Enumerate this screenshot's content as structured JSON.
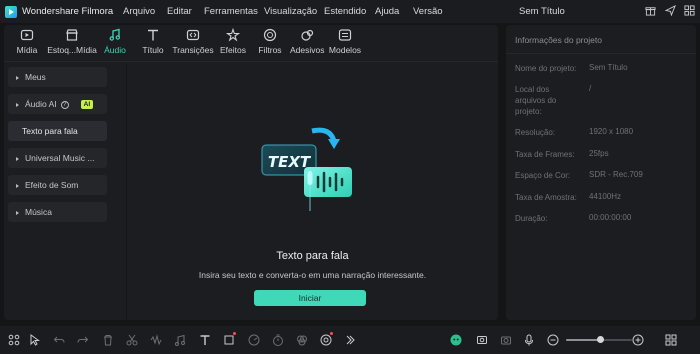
{
  "app": {
    "title": "Wondershare Filmora",
    "document_title": "Sem Título",
    "menu": [
      "Arquivo",
      "Editar",
      "Ferramentas",
      "Visualização",
      "Estendido",
      "Ajuda",
      "Versão"
    ],
    "top_icons": [
      "gift-icon",
      "send-icon",
      "minimize-icon",
      "maximize-icon"
    ]
  },
  "tabs": [
    {
      "label": "Mídia",
      "icon": "media-icon"
    },
    {
      "label": "Estoq...Mídia",
      "icon": "stock-media-icon"
    },
    {
      "label": "Áudio",
      "icon": "music-note-icon",
      "active": true
    },
    {
      "label": "Título",
      "icon": "title-t-icon"
    },
    {
      "label": "Transições",
      "icon": "transition-icon"
    },
    {
      "label": "Efeitos",
      "icon": "effects-icon"
    },
    {
      "label": "Filtros",
      "icon": "filter-icon"
    },
    {
      "label": "Adesivos",
      "icon": "sticker-icon"
    },
    {
      "label": "Modelos",
      "icon": "template-icon"
    }
  ],
  "sidebar": {
    "items": [
      {
        "label": "Meus"
      },
      {
        "label": "Áudio AI",
        "badge": "AI"
      },
      {
        "label": "Texto para fala",
        "selected": true
      },
      {
        "label": "Universal Music ..."
      },
      {
        "label": "Efeito de Som"
      },
      {
        "label": "Música"
      }
    ]
  },
  "center": {
    "illustration_text": "TEXT",
    "title": "Texto para fala",
    "description": "Insira seu texto e converta-o em uma narração interessante.",
    "button": "Iniciar"
  },
  "project_info": {
    "title": "Informações do projeto",
    "fields": [
      {
        "key": "Nome do projeto:",
        "value": "Sem Título"
      },
      {
        "key": "Local dos arquivos do projeto:",
        "value": "/"
      },
      {
        "key": "Resolução:",
        "value": "1920 x 1080"
      },
      {
        "key": "Taxa de Frames:",
        "value": "25fps"
      },
      {
        "key": "Espaço de Cor:",
        "value": "SDR - Rec.709"
      },
      {
        "key": "Taxa de Amostra:",
        "value": "44100Hz"
      },
      {
        "key": "Duração:",
        "value": "00:00:00:00"
      }
    ]
  },
  "colors": {
    "accent": "#3fd8b8",
    "badge": "#c6ef4c",
    "background": "#141517",
    "panel": "#1c1d20"
  },
  "bottom_toolbar": {
    "icons": [
      "layout-icon",
      "select-icon",
      "undo-icon",
      "redo-icon",
      "delete-icon",
      "cut-icon",
      "split-audio-icon",
      "audio-icon",
      "text-icon",
      "crop-icon",
      "speed-icon",
      "timer-icon",
      "color-icon",
      "ai-icon",
      "more-icon",
      "avatar-icon",
      "record-icon",
      "snapshot-icon",
      "mic-icon",
      "zoom-out-icon",
      "zoom-in-icon",
      "grid-icon"
    ],
    "zoom_level": 0.52
  }
}
